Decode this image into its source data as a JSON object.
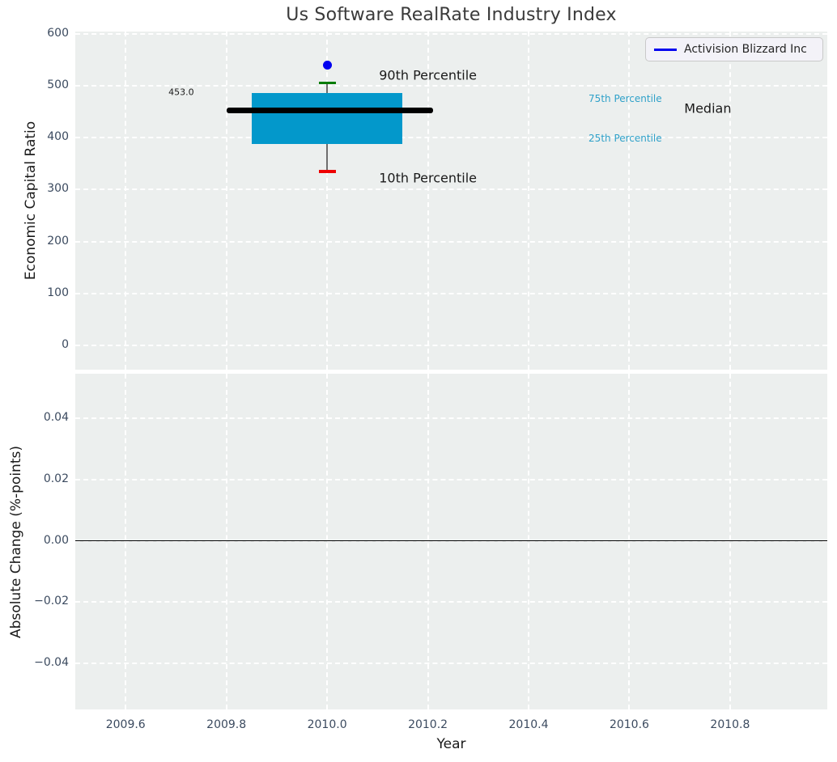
{
  "figure": {
    "background": "#ffffff",
    "axes_background": "#ecefee",
    "grid_color": "#ffffff",
    "tick_color": "#3b4a5f",
    "text_color": "#1a1a1a",
    "title_color": "#3a3a3a"
  },
  "chart_data": [
    {
      "type": "box",
      "title": "Us Software RealRate Industry Index",
      "ylabel": "Economic Capital Ratio",
      "xlim": [
        2009.5,
        2010.993
      ],
      "ylim": [
        -46,
        604
      ],
      "grid": "white dashed, on",
      "xticks": {
        "values": [
          2009.6,
          2009.8,
          2010.0,
          2010.2,
          2010.4,
          2010.6,
          2010.8
        ],
        "labels": [
          "2009.6",
          "2009.8",
          "2010.0",
          "2010.2",
          "2010.4",
          "2010.6",
          "2010.8"
        ]
      },
      "yticks": {
        "values": [
          0,
          100,
          200,
          300,
          400,
          500,
          600
        ],
        "labels": [
          "0",
          "100",
          "200",
          "300",
          "400",
          "500",
          "600"
        ]
      },
      "legend": {
        "position": "upper right",
        "entries": [
          {
            "label": "Activision Blizzard Inc",
            "color": "#0101f0"
          }
        ]
      },
      "box": {
        "x": 2010.0,
        "p10": 335,
        "p25": 388,
        "median": 453,
        "p75": 486,
        "p90": 505,
        "median_label": "453.0",
        "box_x_range": [
          2009.85,
          2010.15
        ],
        "median_x_range": [
          2009.8,
          2010.21
        ],
        "cap_halfwidth": 0.017,
        "box_color": "#0398cb",
        "median_color": "#000000",
        "whisker_color": "#6e6e6e",
        "p90_cap_color": "#067c06",
        "p10_cap_color": "#ee0000"
      },
      "points": [
        {
          "series": "Activision Blizzard Inc",
          "x": 2010.0,
          "y": 539,
          "color": "#0101f0"
        }
      ],
      "annotations": [
        {
          "text": "453.0",
          "x": 2009.685,
          "y": 488,
          "color": "#1a1a1a",
          "size": 11
        },
        {
          "text": "90th Percentile",
          "x": 2010.103,
          "y": 520.8,
          "color": "#1a1a1a",
          "size": 16
        },
        {
          "text": "10th Percentile",
          "x": 2010.103,
          "y": 322.5,
          "color": "#1a1a1a",
          "size": 16
        },
        {
          "text": "75th Percentile",
          "x": 2010.519,
          "y": 475,
          "color": "#2fa1c9",
          "size": 12
        },
        {
          "text": "25th Percentile",
          "x": 2010.519,
          "y": 398.7,
          "color": "#2fa1c9",
          "size": 12
        },
        {
          "text": "Median",
          "x": 2010.709,
          "y": 455.5,
          "color": "#1a1a1a",
          "size": 16
        }
      ]
    },
    {
      "type": "line",
      "ylabel": "Absolute Change (%-points)",
      "xlabel": "Year",
      "xlim": [
        2009.5,
        2010.993
      ],
      "ylim": [
        -0.0551,
        0.0546
      ],
      "grid": "white dashed, on",
      "xticks": {
        "values": [
          2009.6,
          2009.8,
          2010.0,
          2010.2,
          2010.4,
          2010.6,
          2010.8
        ],
        "labels": [
          "2009.6",
          "2009.8",
          "2010.0",
          "2010.2",
          "2010.4",
          "2010.6",
          "2010.8"
        ]
      },
      "yticks": {
        "values": [
          0.04,
          0.02,
          0,
          -0.02,
          -0.04
        ],
        "labels": [
          "0.04",
          "0.02",
          "0.00",
          "−0.02",
          "−0.04"
        ]
      },
      "zero_line": {
        "y": 0,
        "color": "#000000"
      },
      "series": []
    }
  ]
}
